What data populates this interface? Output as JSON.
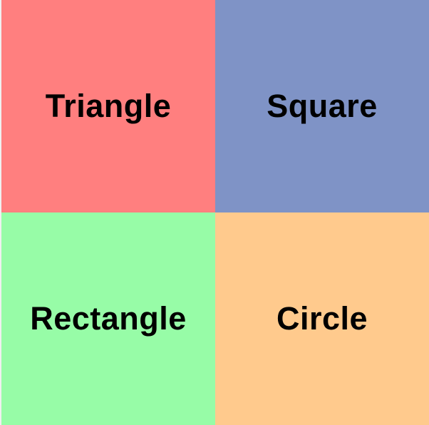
{
  "tiles": [
    {
      "label": "Triangle",
      "color": "#ff7f7f"
    },
    {
      "label": "Square",
      "color": "#7f93c6"
    },
    {
      "label": "Rectangle",
      "color": "#97fca7"
    },
    {
      "label": "Circle",
      "color": "#ffca8d"
    }
  ]
}
